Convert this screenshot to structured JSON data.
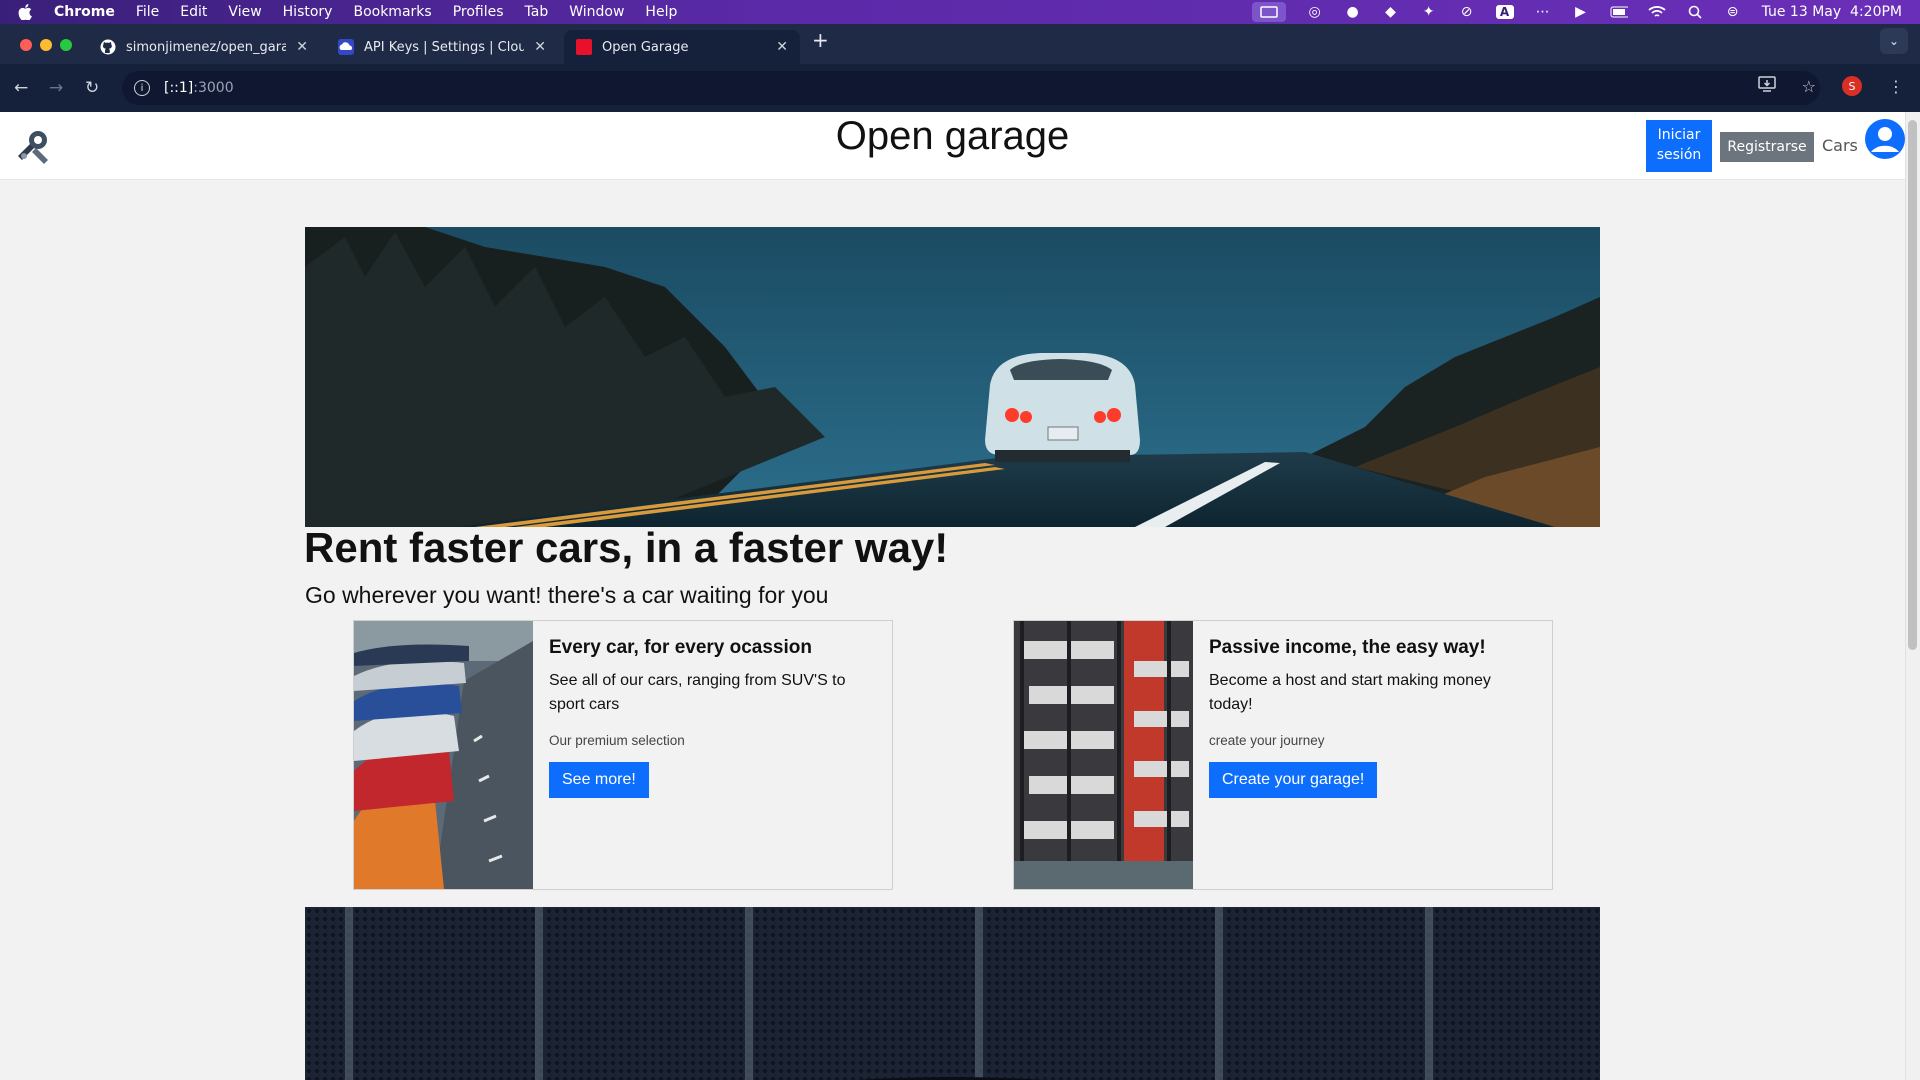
{
  "menubar": {
    "app": "Chrome",
    "items": [
      "File",
      "Edit",
      "View",
      "History",
      "Bookmarks",
      "Profiles",
      "Tab",
      "Window",
      "Help"
    ],
    "datetime": "Tue 13 May  4:20PM"
  },
  "tabs": [
    {
      "title": "simonjimenez/open_garage",
      "icon": "github-icon"
    },
    {
      "title": "API Keys | Settings | Cloudinary",
      "icon": "cloudinary-icon"
    },
    {
      "title": "Open Garage",
      "icon": "red-square-icon",
      "active": true
    }
  ],
  "toolbar": {
    "url_host": "[::1]",
    "url_port": ":3000",
    "profile_initial": "S"
  },
  "navbar": {
    "title": "Open garage",
    "login_label": "Iniciar sesión",
    "register_label": "Registrarse",
    "cars_label": "Cars"
  },
  "hero": {
    "headline": "Rent faster cars, in a faster way!",
    "subheadline": "Go wherever you want! there's a car waiting for you"
  },
  "cards": [
    {
      "title": "Every car, for every ocassion",
      "text": "See all of our cars, ranging from SUV'S to sport cars",
      "muted": "Our premium selection",
      "button": "See more!"
    },
    {
      "title": "Passive income, the easy way!",
      "text": "Become a host and start making money today!",
      "muted": "create your journey",
      "button": "Create your garage!"
    }
  ],
  "colors": {
    "primary": "#0d6efd",
    "secondary": "#6c757d",
    "menubar": "#5b2aa8",
    "chrome_dark": "#15203a"
  }
}
